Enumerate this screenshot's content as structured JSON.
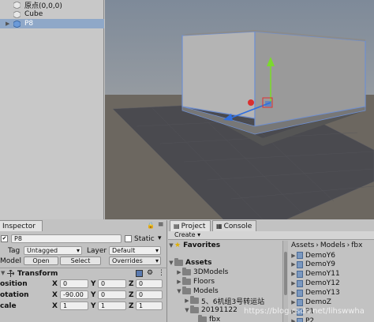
{
  "hierarchy": {
    "items": [
      {
        "label": "原点(0,0,0)"
      },
      {
        "label": "Cube"
      },
      {
        "label": "P8"
      }
    ]
  },
  "inspector": {
    "tab_label": "Inspector",
    "object_name": "P8",
    "static_label": "Static",
    "tag_label": "Tag",
    "tag_value": "Untagged",
    "layer_label": "Layer",
    "layer_value": "Default",
    "model_label": "Model",
    "open_label": "Open",
    "select_label": "Select",
    "overrides_label": "Overrides",
    "transform_label": "Transform",
    "rows": [
      {
        "label": "osition",
        "x": "0",
        "y": "0",
        "z": "0"
      },
      {
        "label": "otation",
        "x": "-90.00",
        "y": "0",
        "z": "0"
      },
      {
        "label": "cale",
        "x": "1",
        "y": "1",
        "z": "1"
      }
    ],
    "axis_x": "X",
    "axis_y": "Y",
    "axis_z": "Z"
  },
  "project": {
    "tab_project": "Project",
    "tab_console": "Console",
    "create_label": "Create",
    "tree": [
      {
        "label": "Favorites",
        "bold": true
      },
      {
        "label": "Assets",
        "bold": true
      },
      {
        "label": "3DModels"
      },
      {
        "label": "Floors"
      },
      {
        "label": "Models"
      },
      {
        "label": "5、6机组3号转运站"
      },
      {
        "label": "20191122"
      },
      {
        "label": "fbx"
      }
    ],
    "breadcrumb": [
      "Assets",
      "Models",
      "fbx"
    ],
    "files": [
      "DemoY6",
      "DemoY9",
      "DemoY11",
      "DemoY12",
      "DemoY13",
      "DemoZ",
      "P1",
      "P2"
    ]
  },
  "watermark": "https://blog.csdn.net/lihswwha",
  "colors": {
    "selection": "#8fa8c8",
    "scene_sky": "#8a8f96",
    "scene_ground": "#6e6a64",
    "gizmo_y": "#7cd92d",
    "gizmo_z": "#2f6fe0",
    "gizmo_x": "#e03030"
  }
}
